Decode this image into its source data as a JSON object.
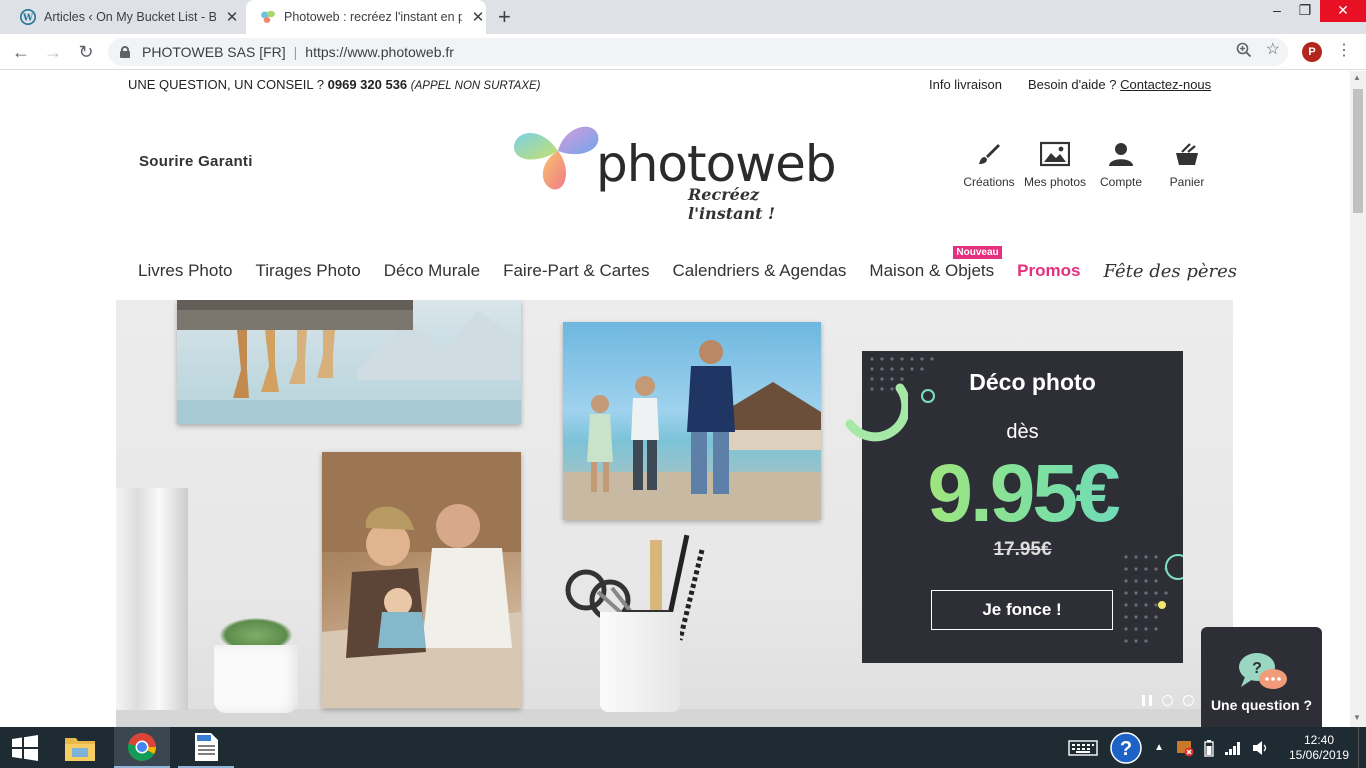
{
  "browser": {
    "tabs": [
      {
        "title": "Articles ‹ On My Bucket List - Bie",
        "favicon": "wordpress-icon"
      },
      {
        "title": "Photoweb : recréez l'instant en p",
        "favicon": "photoweb-butterfly-icon"
      }
    ],
    "new_tab_symbol": "+",
    "window": {
      "minimize": "–",
      "restore": "❐",
      "close": "✕"
    },
    "site_identity": "PHOTOWEB SAS [FR]",
    "url": "https://www.photoweb.fr",
    "profile_initial": "P"
  },
  "page": {
    "topbar": {
      "question_prefix": "UNE QUESTION, UN CONSEIL ?",
      "phone": "0969 320 536",
      "phone_note": "(APPEL NON SURTAXE)",
      "info_livraison": "Info livraison",
      "aide_prefix": "Besoin d'aide ?",
      "contact_link": "Contactez-nous"
    },
    "sourire": "Sourire Garanti",
    "logo": {
      "name": "photoweb",
      "tagline": "Recréez l'instant !"
    },
    "shop_icons": [
      {
        "label": "Créations",
        "icon": "brush-icon"
      },
      {
        "label": "Mes photos",
        "icon": "image-icon"
      },
      {
        "label": "Compte",
        "icon": "user-icon"
      },
      {
        "label": "Panier",
        "icon": "cart-icon"
      }
    ],
    "nav": {
      "items": [
        "Livres Photo",
        "Tirages Photo",
        "Déco Murale",
        "Faire-Part & Cartes",
        "Calendriers & Agendas",
        "Maison & Objets",
        "Promos",
        "Fête des pères"
      ],
      "new_badge": "Nouveau"
    },
    "hero": {
      "title": "Déco photo",
      "from": "dès",
      "price": "9.95€",
      "old_price": "17.95€",
      "cta": "Je fonce !",
      "active_slide": 1,
      "slide_count": 3
    },
    "help_widget": {
      "label": "Une question ?"
    }
  },
  "taskbar": {
    "time": "12:40",
    "date": "15/06/2019"
  },
  "colors": {
    "accent_pink": "#e5307e",
    "promo_bg": "#2e2f36",
    "price_green": "#9be07a",
    "taskbar_bg": "#1f2b33"
  }
}
